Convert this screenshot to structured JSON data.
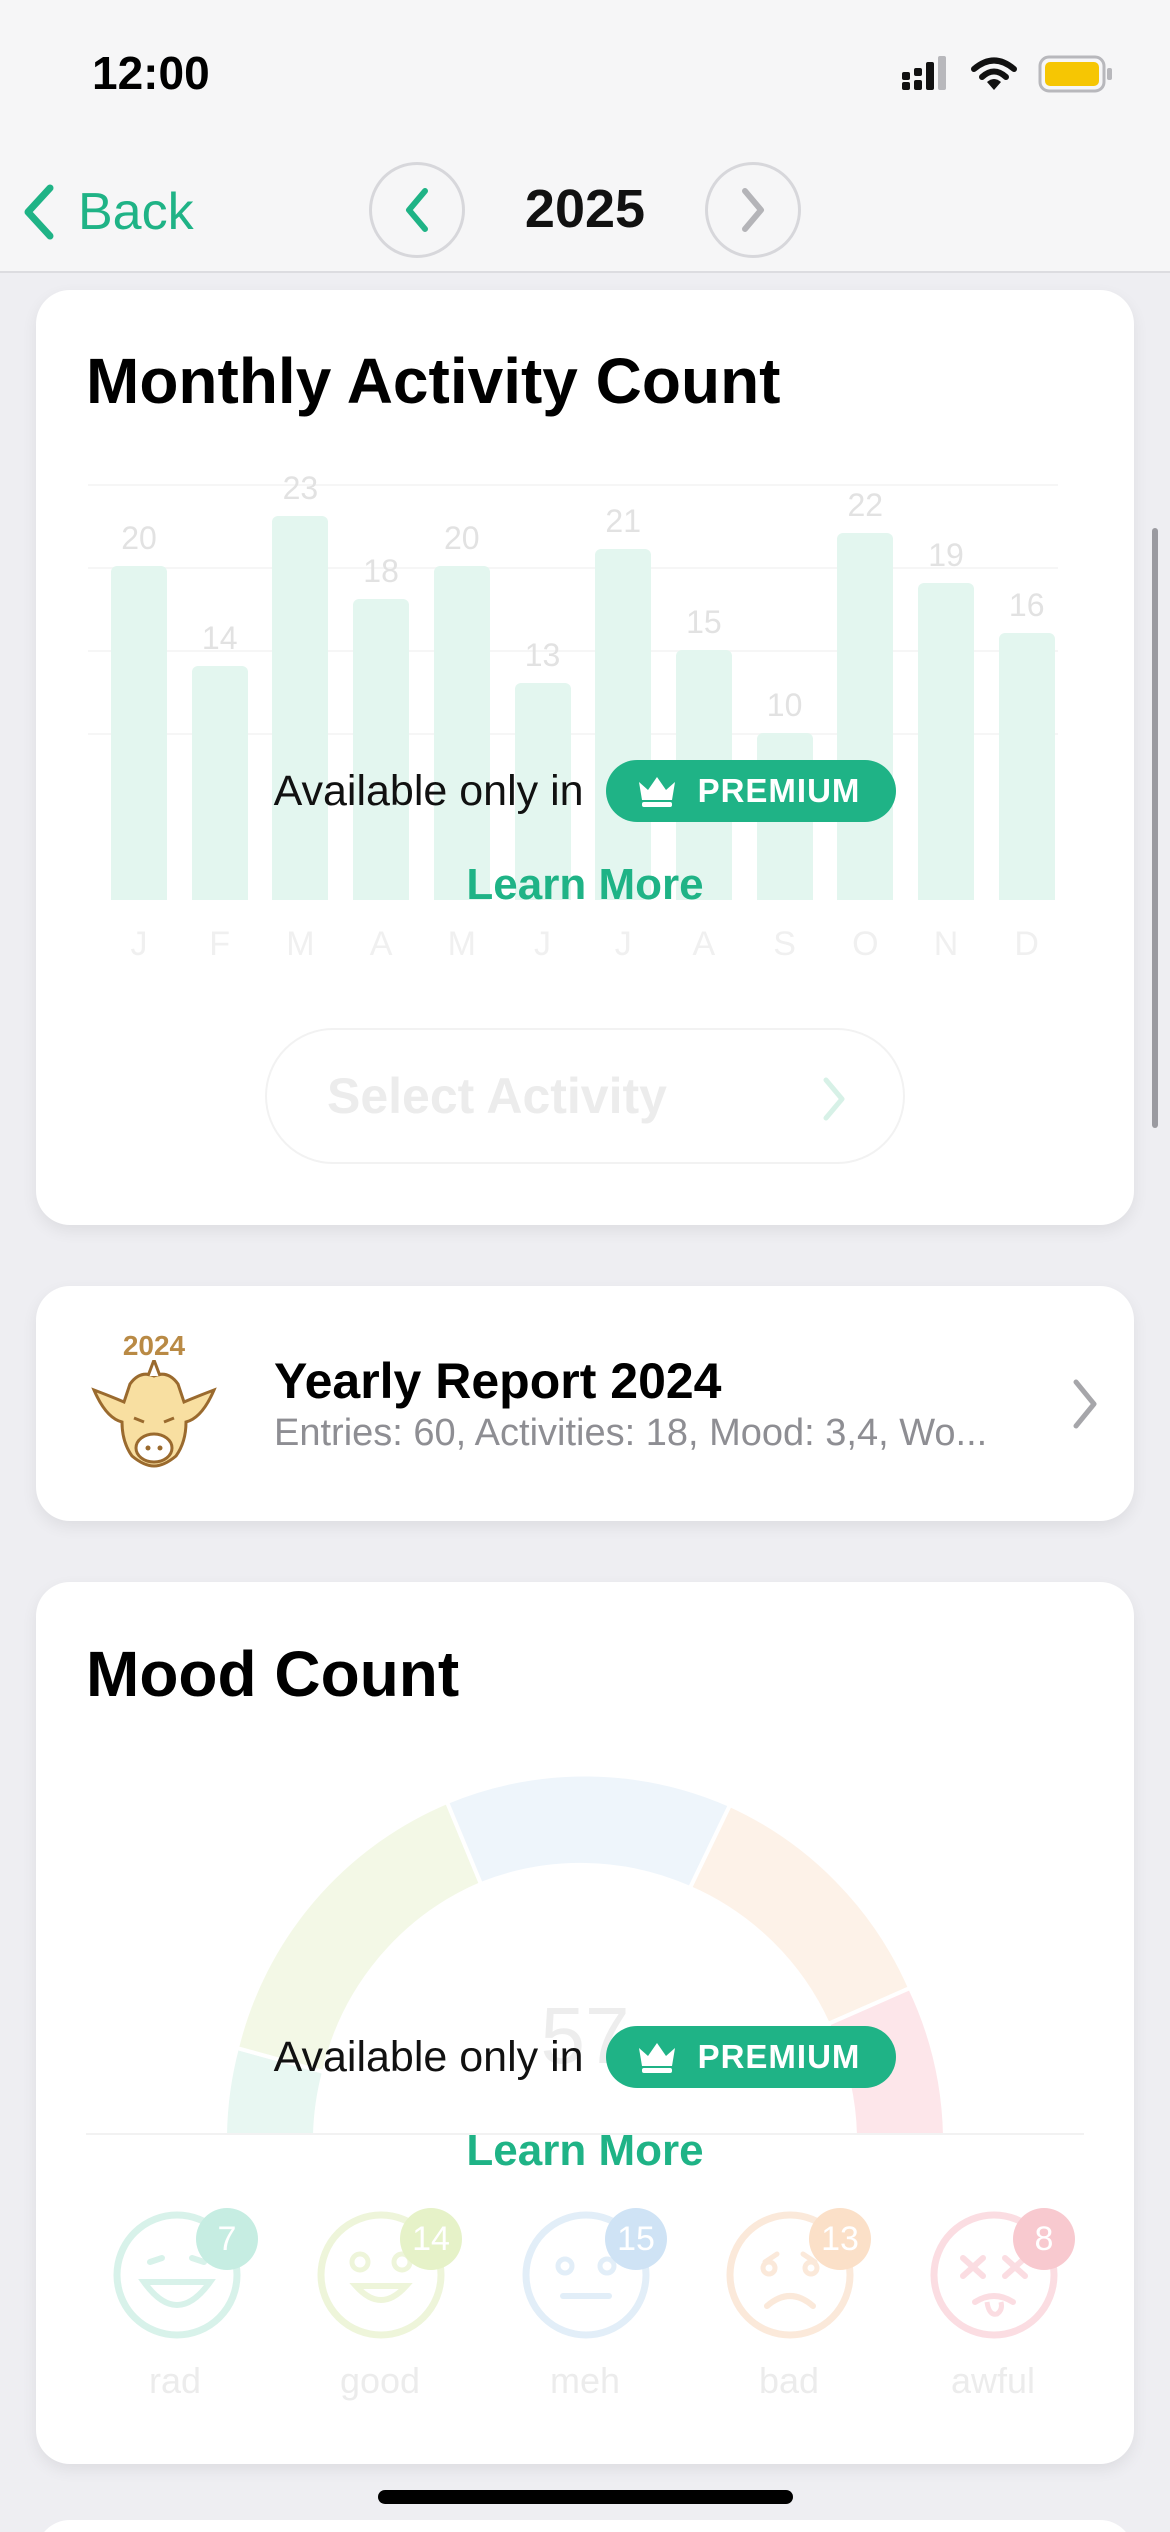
{
  "status": {
    "time": "12:00"
  },
  "nav": {
    "back_label": "Back",
    "year": "2025"
  },
  "activity_card": {
    "title": "Monthly Activity Count",
    "overlay_text": "Available only in",
    "premium_label": "PREMIUM",
    "learn_more": "Learn More",
    "select_label": "Select Activity"
  },
  "chart_data": {
    "type": "bar",
    "categories": [
      "J",
      "F",
      "M",
      "A",
      "M",
      "J",
      "J",
      "A",
      "S",
      "O",
      "N",
      "D"
    ],
    "values": [
      20,
      14,
      23,
      18,
      20,
      13,
      21,
      15,
      10,
      22,
      19,
      16
    ],
    "title": "Monthly Activity Count",
    "ylim": [
      0,
      25
    ],
    "grid": true
  },
  "report_card": {
    "badge_year": "2024",
    "title": "Yearly Report 2024",
    "subtitle": "Entries: 60, Activities: 18, Mood: 3,4, Wo..."
  },
  "mood_card": {
    "title": "Mood Count",
    "total": "57",
    "overlay_text": "Available only in",
    "premium_label": "PREMIUM",
    "learn_more": "Learn More",
    "moods": [
      {
        "label": "rad",
        "count": "7",
        "color": "#c6ede2"
      },
      {
        "label": "good",
        "count": "14",
        "color": "#e6f2c8"
      },
      {
        "label": "meh",
        "count": "15",
        "color": "#cfe3f5"
      },
      {
        "label": "bad",
        "count": "13",
        "color": "#fbe0c8"
      },
      {
        "label": "awful",
        "count": "8",
        "color": "#f8c9cf"
      }
    ]
  },
  "colors": {
    "accent": "#1fb386"
  }
}
